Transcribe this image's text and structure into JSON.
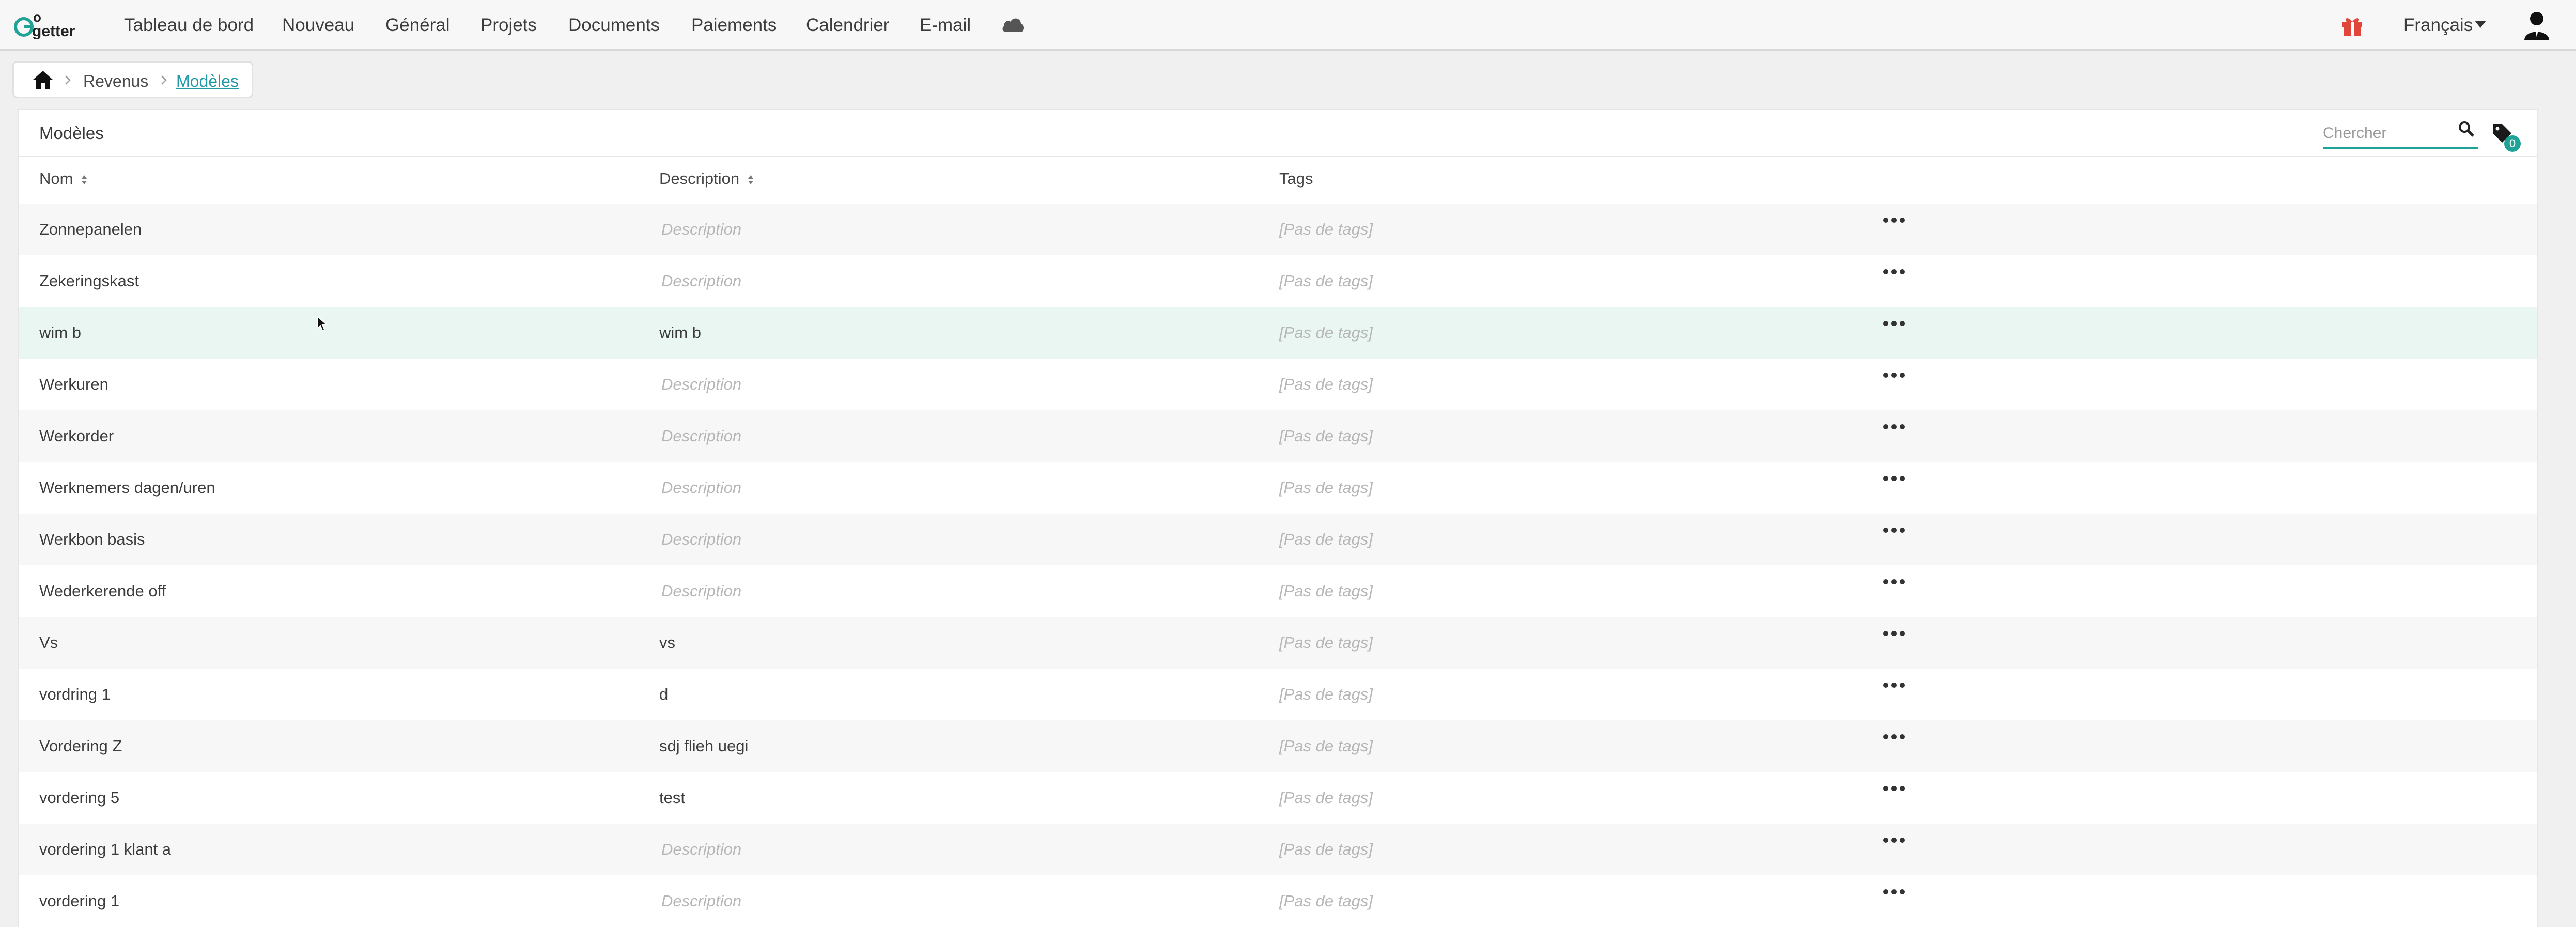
{
  "brand": {
    "logo_text": "GoGetter",
    "accent": "#1fa396",
    "link": "#1f9aa6",
    "highlight_row": "#e9f6f1"
  },
  "nav": {
    "items": [
      {
        "label": "Tableau de bord"
      },
      {
        "label": "Nouveau"
      },
      {
        "label": "Général"
      },
      {
        "label": "Projets"
      },
      {
        "label": "Documents"
      },
      {
        "label": "Paiements"
      },
      {
        "label": "Calendrier"
      },
      {
        "label": "E-mail"
      }
    ],
    "cloud_icon": "cloud-icon",
    "gift_icon": "gift-icon",
    "language": "Français",
    "user_icon": "user-icon"
  },
  "breadcrumb": {
    "home_icon": "home-icon",
    "items": [
      {
        "label": "Revenus"
      },
      {
        "label": "Modèles"
      }
    ]
  },
  "panel": {
    "title": "Modèles",
    "search": {
      "placeholder": "Chercher"
    },
    "tag_filter_count": "0"
  },
  "table": {
    "columns": [
      {
        "label": "Nom",
        "sortable": true
      },
      {
        "label": "Description",
        "sortable": true
      },
      {
        "label": "Tags",
        "sortable": false
      }
    ],
    "rows": [
      {
        "name": "Zonnepanelen",
        "description": "Description",
        "description_empty": true,
        "tags": "[Pas de tags]"
      },
      {
        "name": "Zekeringskast",
        "description": "Description",
        "description_empty": true,
        "tags": "[Pas de tags]"
      },
      {
        "name": "wim b",
        "description": "wim b",
        "description_empty": false,
        "tags": "[Pas de tags]",
        "hovered": true
      },
      {
        "name": "Werkuren",
        "description": "Description",
        "description_empty": true,
        "tags": "[Pas de tags]"
      },
      {
        "name": "Werkorder",
        "description": "Description",
        "description_empty": true,
        "tags": "[Pas de tags]"
      },
      {
        "name": "Werknemers dagen/uren",
        "description": "Description",
        "description_empty": true,
        "tags": "[Pas de tags]"
      },
      {
        "name": "Werkbon basis",
        "description": "Description",
        "description_empty": true,
        "tags": "[Pas de tags]"
      },
      {
        "name": "Wederkerende off",
        "description": "Description",
        "description_empty": true,
        "tags": "[Pas de tags]"
      },
      {
        "name": "Vs",
        "description": "vs",
        "description_empty": false,
        "tags": "[Pas de tags]"
      },
      {
        "name": "vordring 1",
        "description": "d",
        "description_empty": false,
        "tags": "[Pas de tags]"
      },
      {
        "name": "Vordering Z",
        "description": "sdj flieh uegi",
        "description_empty": false,
        "tags": "[Pas de tags]"
      },
      {
        "name": "vordering 5",
        "description": "test",
        "description_empty": false,
        "tags": "[Pas de tags]"
      },
      {
        "name": "vordering 1 klant a",
        "description": "Description",
        "description_empty": true,
        "tags": "[Pas de tags]"
      },
      {
        "name": "vordering 1",
        "description": "Description",
        "description_empty": true,
        "tags": "[Pas de tags]"
      }
    ],
    "row_action_icon": "more-horizontal-icon"
  }
}
